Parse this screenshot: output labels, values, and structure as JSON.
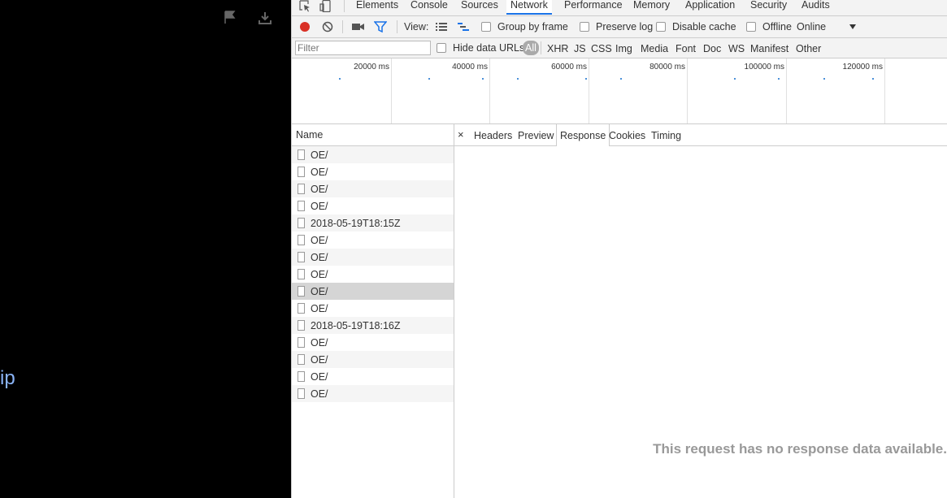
{
  "left_panel": {
    "partial_text": "ip"
  },
  "devtools": {
    "tabs": [
      "Elements",
      "Console",
      "Sources",
      "Network",
      "Performance",
      "Memory",
      "Application",
      "Security",
      "Audits"
    ],
    "active_tab": "Network",
    "toolbar": {
      "view_label": "View:",
      "group_by_frame": "Group by frame",
      "preserve_log": "Preserve log",
      "disable_cache": "Disable cache",
      "offline": "Offline",
      "throttling": "Online"
    },
    "filter": {
      "placeholder": "Filter",
      "hide_data_urls": "Hide data URLs",
      "types": [
        "All",
        "XHR",
        "JS",
        "CSS",
        "Img",
        "Media",
        "Font",
        "Doc",
        "WS",
        "Manifest",
        "Other"
      ]
    },
    "overview": {
      "labels": [
        "20000 ms",
        "40000 ms",
        "60000 ms",
        "80000 ms",
        "100000 ms",
        "120000 ms"
      ]
    },
    "requests": {
      "header": "Name",
      "items": [
        "OE/",
        "OE/",
        "OE/",
        "OE/",
        "2018-05-19T18:15Z",
        "OE/",
        "OE/",
        "OE/",
        "OE/",
        "OE/",
        "2018-05-19T18:16Z",
        "OE/",
        "OE/",
        "OE/",
        "OE/"
      ],
      "selected_index": 8
    },
    "detail": {
      "tabs": [
        "Headers",
        "Preview",
        "Response",
        "Cookies",
        "Timing"
      ],
      "active_tab": "Response",
      "close_symbol": "×",
      "message": "This request has no response data available."
    },
    "colors": {
      "record": "#d93025",
      "filter_active": "#1a73e8"
    }
  }
}
